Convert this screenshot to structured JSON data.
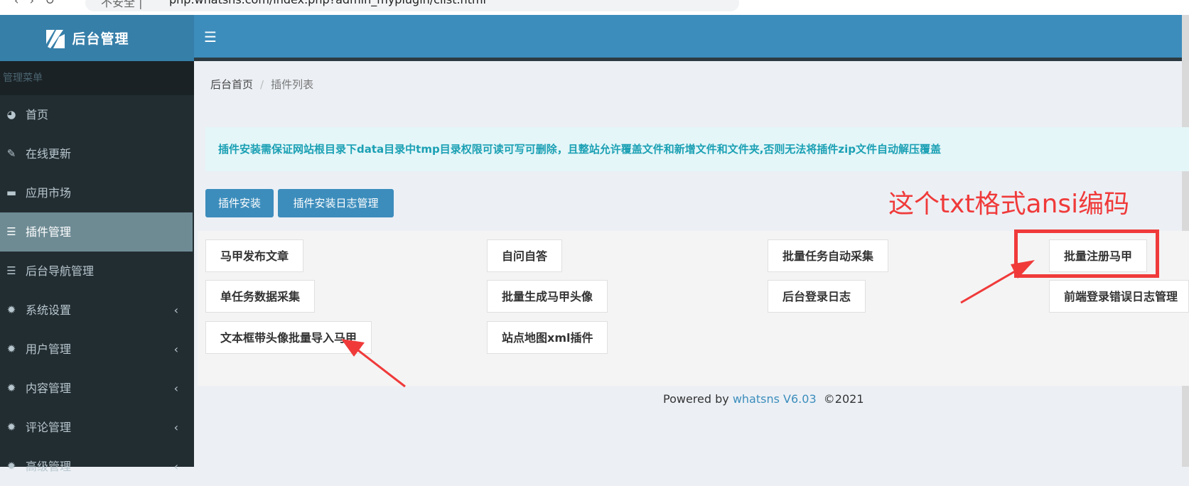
{
  "browser": {
    "security_label": "不安全 |",
    "url": "php.whatsns.com/index.php?admin_myplugin/clist.html"
  },
  "header": {
    "logo_text": "后台管理",
    "toggle_icon": "hamburger-icon"
  },
  "sidebar": {
    "header": "管理菜单",
    "items": [
      {
        "label": "首页",
        "icon": "dashboard-icon",
        "active": false,
        "expandable": false
      },
      {
        "label": "在线更新",
        "icon": "wrench-icon",
        "active": false,
        "expandable": false
      },
      {
        "label": "应用市场",
        "icon": "cart-icon",
        "active": false,
        "expandable": false
      },
      {
        "label": "插件管理",
        "icon": "list-icon",
        "active": true,
        "expandable": false
      },
      {
        "label": "后台导航管理",
        "icon": "list-icon",
        "active": false,
        "expandable": false
      },
      {
        "label": "系统设置",
        "icon": "gear-icon",
        "active": false,
        "expandable": true
      },
      {
        "label": "用户管理",
        "icon": "gear-icon",
        "active": false,
        "expandable": true
      },
      {
        "label": "内容管理",
        "icon": "gear-icon",
        "active": false,
        "expandable": true
      },
      {
        "label": "评论管理",
        "icon": "gear-icon",
        "active": false,
        "expandable": true
      },
      {
        "label": "高级管理",
        "icon": "gear-icon",
        "active": false,
        "expandable": true
      }
    ]
  },
  "breadcrumb": {
    "home": "后台首页",
    "separator": "/",
    "current": "插件列表"
  },
  "alert": {
    "text": "插件安装需保证网站根目录下data目录中tmp目录权限可读可写可删除，且整站允许覆盖文件和新增文件和文件夹,否则无法将插件zip文件自动解压覆盖"
  },
  "buttons": {
    "install": "插件安装",
    "install_log": "插件安装日志管理"
  },
  "plugins": [
    "马甲发布文章",
    "自问自答",
    "批量任务自动采集",
    "批量注册马甲",
    "单任务数据采集",
    "批量生成马甲头像",
    "后台登录日志",
    "前端登录错误日志管理",
    "文本框带头像批量导入马甲",
    "站点地图xml插件"
  ],
  "footer": {
    "powered_by": "Powered by",
    "brand": "whatsns",
    "version": "V6.03",
    "copyright": "©2021"
  },
  "annotation": {
    "text": "这个txt格式ansi编码",
    "color": "#f03a3a"
  },
  "colors": {
    "topbar": "#3c8dbc",
    "logo_bg": "#367fa9",
    "sidebar": "#222d32",
    "sidebar_active": "#6e8b94",
    "alert_bg": "#e4f6f8",
    "alert_text": "#1ba0b4"
  }
}
